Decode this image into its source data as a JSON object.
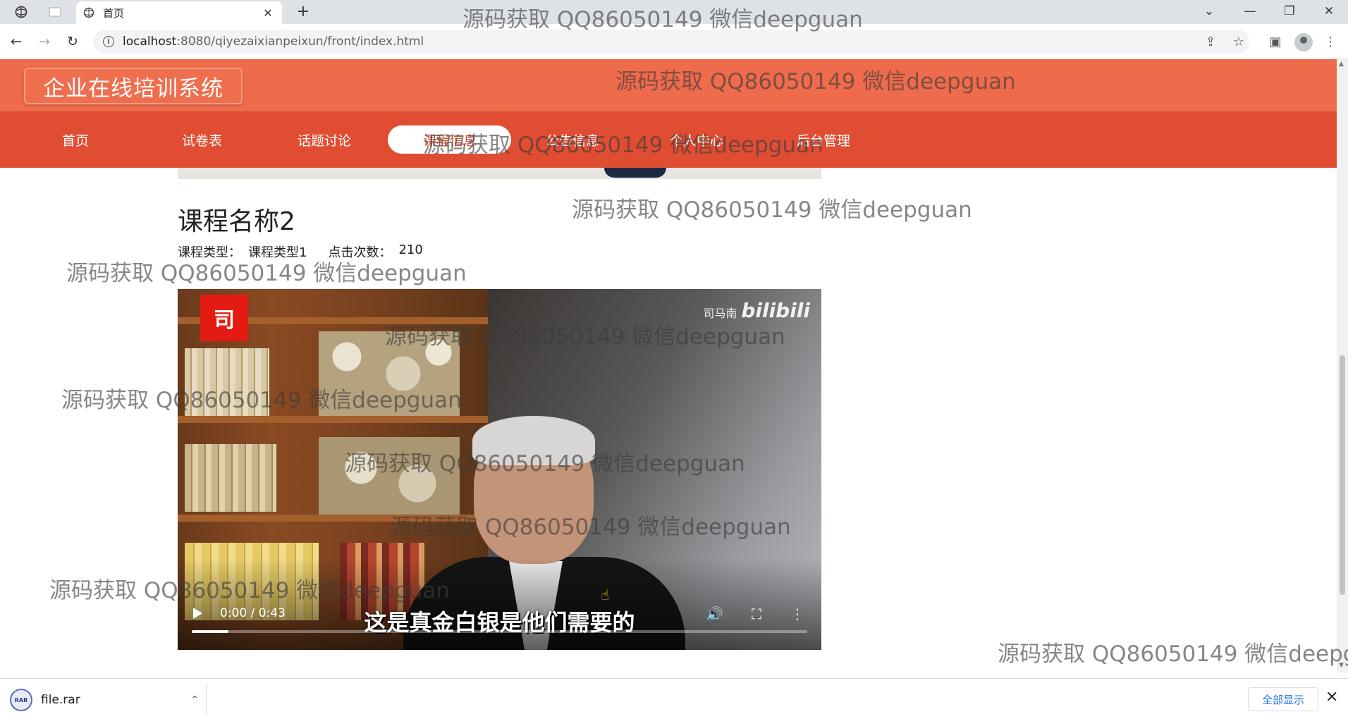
{
  "browser": {
    "tab_title": "首页",
    "new_tab": "+",
    "url_host": "localhost",
    "url_rest": ":8080/qiyezaixianpeixun/front/index.html"
  },
  "site": {
    "title": "企业在线培训系统",
    "nav": [
      "首页",
      "试卷表",
      "话题讨论",
      "课程信息",
      "公告信息",
      "个人中心",
      "后台管理"
    ],
    "active_nav_index": 3
  },
  "course": {
    "name": "课程名称2",
    "type_label": "课程类型：",
    "type_value": "课程类型1",
    "clicks_label": "点击次数：",
    "clicks_value": "210"
  },
  "video": {
    "time": "0:00 / 0:43",
    "subtitle": "这是真金白银是他们需要的",
    "brand_name": "司马南",
    "brand_logo": "bilibili",
    "logo_char": "司",
    "progress_fraction": 0.06,
    "icons": [
      "play-icon",
      "volume-icon",
      "fullscreen-icon",
      "more-icon"
    ]
  },
  "download": {
    "file_name": "file.rar",
    "icon_text": "RAR",
    "show_all": "全部显示"
  },
  "watermark": "源码获取 QQ86050149 微信deepguan",
  "colors": {
    "header": "#ee6b4b",
    "nav": "#e04d33",
    "active_text": "#e04d33"
  }
}
